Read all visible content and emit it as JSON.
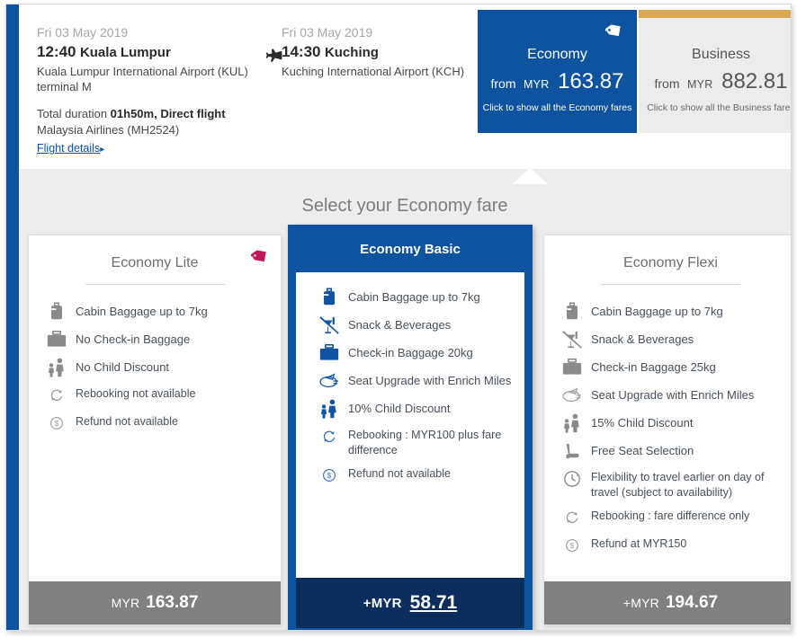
{
  "flight": {
    "departure": {
      "date": "Fri 03 May 2019",
      "time": "12:40",
      "city": "Kuala Lumpur",
      "airport": "Kuala Lumpur International Airport (KUL)",
      "terminal": "terminal M"
    },
    "arrival": {
      "date": "Fri 03 May 2019",
      "time": "14:30",
      "city": "Kuching",
      "airport": "Kuching International Airport (KCH)",
      "terminal": ""
    },
    "duration_prefix": "Total duration ",
    "duration_value": "01h50m, Direct flight",
    "airline": "Malaysia Airlines (MH2524)",
    "details_link": "Flight details",
    "details_caret": "▸",
    "plane_icon": "airplane-icon"
  },
  "cabins": [
    {
      "name": "Economy",
      "from_label": "from",
      "currency": "MYR",
      "amount": "163.87",
      "hint": "Click to show all the Economy fares",
      "selected": true,
      "tag_icon": "price-tag-icon"
    },
    {
      "name": "Business",
      "from_label": "from",
      "currency": "MYR",
      "amount": "882.81",
      "hint": "Click to show all the Business fares",
      "selected": false,
      "accent_color": "#d9a850"
    }
  ],
  "panel": {
    "title": "Select your Economy fare"
  },
  "fares": [
    {
      "name": "Economy Lite",
      "highlighted": false,
      "tag_icon": "price-tag-icon",
      "features": [
        {
          "icon": "cabin-baggage-icon",
          "text": "Cabin Baggage up to 7kg",
          "style": "gray-solid"
        },
        {
          "icon": "checkin-baggage-icon",
          "text": "No Check-in Baggage",
          "style": "gray-solid"
        },
        {
          "icon": "child-discount-icon",
          "text": "No Child Discount",
          "style": "gray-solid"
        },
        {
          "icon": "rebooking-icon",
          "text": "Rebooking not available",
          "style": "gray-line"
        },
        {
          "icon": "refund-icon",
          "text": "Refund not available",
          "style": "gray-line"
        }
      ],
      "price": {
        "currency": "MYR",
        "amount": "163.87",
        "prefix": ""
      }
    },
    {
      "name": "Economy Basic",
      "highlighted": true,
      "features": [
        {
          "icon": "cabin-baggage-icon",
          "text": "Cabin Baggage up to 7kg",
          "style": "blue-solid"
        },
        {
          "icon": "snack-beverages-icon",
          "text": "Snack & Beverages",
          "style": "blue-solid"
        },
        {
          "icon": "checkin-baggage-icon",
          "text": "Check-in Baggage 20kg",
          "style": "blue-solid"
        },
        {
          "icon": "seat-upgrade-icon",
          "text": "Seat Upgrade with Enrich Miles",
          "style": "blue-line"
        },
        {
          "icon": "child-discount-icon",
          "text": "10% Child Discount",
          "style": "blue-solid"
        },
        {
          "icon": "rebooking-icon",
          "text": "Rebooking : MYR100 plus fare difference",
          "style": "blue-line"
        },
        {
          "icon": "refund-icon",
          "text": "Refund not available",
          "style": "blue-line"
        }
      ],
      "price": {
        "currency": "MYR",
        "amount": "58.71",
        "prefix": "+"
      }
    },
    {
      "name": "Economy Flexi",
      "highlighted": false,
      "features": [
        {
          "icon": "cabin-baggage-icon",
          "text": "Cabin Baggage up to 7kg",
          "style": "gray-solid"
        },
        {
          "icon": "snack-beverages-icon",
          "text": "Snack & Beverages",
          "style": "gray-solid"
        },
        {
          "icon": "checkin-baggage-icon",
          "text": "Check-in Baggage 25kg",
          "style": "gray-solid"
        },
        {
          "icon": "seat-upgrade-icon",
          "text": "Seat Upgrade with Enrich Miles",
          "style": "gray-line"
        },
        {
          "icon": "child-discount-icon",
          "text": "15% Child Discount",
          "style": "gray-solid"
        },
        {
          "icon": "seat-selection-icon",
          "text": "Free Seat Selection",
          "style": "gray-solid"
        },
        {
          "icon": "clock-icon",
          "text": "Flexibility to travel earlier on day of travel (subject to availability)",
          "style": "gray-line"
        },
        {
          "icon": "rebooking-icon",
          "text": "Rebooking : fare difference only",
          "style": "gray-line"
        },
        {
          "icon": "refund-icon",
          "text": "Refund at MYR150",
          "style": "gray-line"
        }
      ],
      "price": {
        "currency": "MYR",
        "amount": "194.67",
        "prefix": "+"
      }
    }
  ],
  "colors": {
    "brand_blue": "#0d53a0",
    "dark_navy": "#0b2d5e",
    "gold": "#d9a850",
    "tag_pink": "#c2185b",
    "footer_gray": "#808080",
    "panel_gray": "#ededed"
  }
}
